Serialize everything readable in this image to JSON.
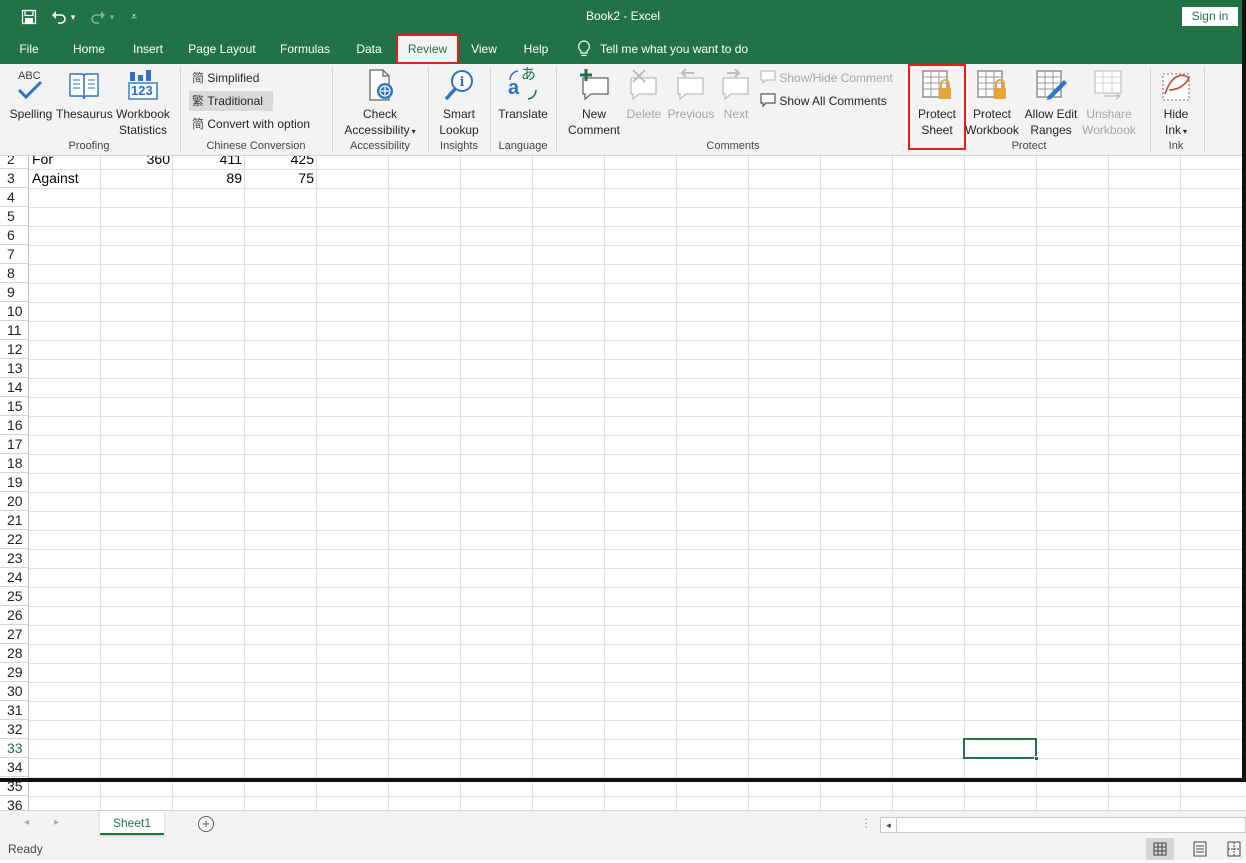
{
  "title": {
    "doc": "Book2",
    "sep": " - ",
    "app": "Excel"
  },
  "signin_label": "Sign in",
  "quick_access": {
    "save_icon": "save-icon",
    "undo_icon": "undo-icon",
    "redo_icon": "redo-icon",
    "customize_icon": "customize-icon"
  },
  "tabs": [
    "File",
    "Home",
    "Insert",
    "Page Layout",
    "Formulas",
    "Data",
    "Review",
    "View",
    "Help"
  ],
  "active_tab": "Review",
  "tell_me": "Tell me what you want to do",
  "ribbon": {
    "proofing": {
      "label": "Proofing",
      "spelling": "Spelling",
      "spelling_abc": "ABC",
      "thesaurus": "Thesaurus",
      "workbook_stats": [
        "Workbook",
        "Statistics"
      ],
      "stats_glyph": "123"
    },
    "chinese": {
      "label": "Chinese Conversion",
      "simplified": "Simplified",
      "traditional": "Traditional",
      "convert": "Convert with option",
      "glyph_simplified": "简",
      "glyph_traditional": "繁",
      "glyph_convert": "简"
    },
    "accessibility": {
      "label": "Accessibility",
      "check": [
        "Check",
        "Accessibility"
      ]
    },
    "insights": {
      "label": "Insights",
      "smart": [
        "Smart",
        "Lookup"
      ]
    },
    "language": {
      "label": "Language",
      "translate": "Translate",
      "glyph_a": "a",
      "glyph_jp": "あ"
    },
    "comments": {
      "label": "Comments",
      "new": [
        "New",
        "Comment"
      ],
      "delete": "Delete",
      "previous": "Previous",
      "next": "Next",
      "show_hide": "Show/Hide Comment",
      "show_all": "Show All Comments"
    },
    "protect": {
      "label": "Protect",
      "protect_sheet": [
        "Protect",
        "Sheet"
      ],
      "protect_workbook": [
        "Protect",
        "Workbook"
      ],
      "allow_edit": [
        "Allow Edit",
        "Ranges"
      ],
      "unshare": [
        "Unshare",
        "Workbook"
      ]
    },
    "ink": {
      "label": "Ink",
      "hide_ink": [
        "Hide",
        "Ink"
      ]
    }
  },
  "grid": {
    "rows": [
      {
        "num": "2",
        "cells": [
          "For",
          "360",
          "411",
          "425"
        ]
      },
      {
        "num": "3",
        "cells": [
          "Against",
          "",
          "89",
          "75"
        ]
      },
      {
        "num": "4"
      },
      {
        "num": "5"
      },
      {
        "num": "6"
      },
      {
        "num": "7"
      },
      {
        "num": "8"
      },
      {
        "num": "9"
      },
      {
        "num": "10"
      },
      {
        "num": "11"
      },
      {
        "num": "12"
      },
      {
        "num": "13"
      },
      {
        "num": "14"
      },
      {
        "num": "15"
      },
      {
        "num": "16"
      },
      {
        "num": "17"
      },
      {
        "num": "18"
      },
      {
        "num": "19"
      },
      {
        "num": "20"
      },
      {
        "num": "21"
      },
      {
        "num": "22"
      },
      {
        "num": "23"
      },
      {
        "num": "24"
      },
      {
        "num": "25"
      },
      {
        "num": "26"
      },
      {
        "num": "27"
      },
      {
        "num": "28"
      },
      {
        "num": "29"
      },
      {
        "num": "30"
      },
      {
        "num": "31"
      },
      {
        "num": "32"
      },
      {
        "num": "33"
      },
      {
        "num": "34"
      },
      {
        "num": "35"
      },
      {
        "num": "36"
      }
    ],
    "selected_row": "33"
  },
  "sheets": [
    "Sheet1"
  ],
  "status": "Ready",
  "colors": {
    "excel_green": "#217346",
    "highlight_red": "#e02020",
    "ribbon_bg": "#f3f3f3",
    "lock_gold": "#e8a33d",
    "accessibility_blue": "#2b73c4"
  }
}
